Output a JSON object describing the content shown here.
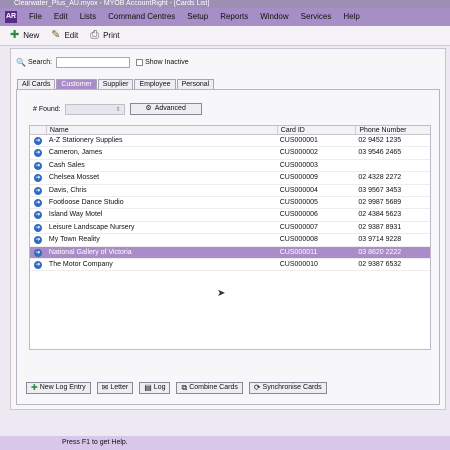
{
  "window": {
    "title": "Clearwater_Plus_AU.myox - MYOB AccountRight - [Cards List]"
  },
  "app_logo_text": "AR",
  "menu": [
    "File",
    "Edit",
    "Lists",
    "Command Centres",
    "Setup",
    "Reports",
    "Window",
    "Services",
    "Help"
  ],
  "toolbar": {
    "new_label": "New",
    "edit_label": "Edit",
    "print_label": "Print"
  },
  "search": {
    "label": "Search:",
    "value": "",
    "show_inactive_label": "Show Inactive"
  },
  "tabs": [
    "All Cards",
    "Customer",
    "Supplier",
    "Employee",
    "Personal"
  ],
  "active_tab": "Customer",
  "found": {
    "label": "# Found:",
    "value": ""
  },
  "advanced_label": "Advanced",
  "columns": {
    "name": "Name",
    "card_id": "Card ID",
    "phone": "Phone Number"
  },
  "rows": [
    {
      "name": "A-Z Stationery Supplies",
      "card_id": "CUS000001",
      "phone": "02 9452 1235"
    },
    {
      "name": "Cameron, James",
      "card_id": "CUS000002",
      "phone": "03 9546 2465"
    },
    {
      "name": "Cash Sales",
      "card_id": "CUS000003",
      "phone": ""
    },
    {
      "name": "Chelsea Mosset",
      "card_id": "CUS000009",
      "phone": "02 4328 2272"
    },
    {
      "name": "Davis, Chris",
      "card_id": "CUS000004",
      "phone": "03 9567 3453"
    },
    {
      "name": "Footloose Dance Studio",
      "card_id": "CUS000005",
      "phone": "02 9987 5689"
    },
    {
      "name": "Island Way Motel",
      "card_id": "CUS000006",
      "phone": "02 4384 5623"
    },
    {
      "name": "Leisure Landscape Nursery",
      "card_id": "CUS000007",
      "phone": "02 9387 8931"
    },
    {
      "name": "My Town Reality",
      "card_id": "CUS000008",
      "phone": "03 9714 9228"
    },
    {
      "name": "National Gallery of Victoria",
      "card_id": "CUS000011",
      "phone": "03 8620 2222",
      "selected": true
    },
    {
      "name": "The Motor Company",
      "card_id": "CUS000010",
      "phone": "02 9387 6532"
    }
  ],
  "bottom_buttons": {
    "new_log_entry": "New Log Entry",
    "letter": "Letter",
    "log": "Log",
    "combine_cards": "Combine Cards",
    "synchronise_cards": "Synchronise Cards"
  },
  "status": {
    "text": "Press F1 to get Help."
  },
  "colors": {
    "menubar": "#a68fc6",
    "selected_row": "#a98cc8",
    "status_bar": "#d8c7ea",
    "arrow_icon": "#2f6bc1"
  }
}
